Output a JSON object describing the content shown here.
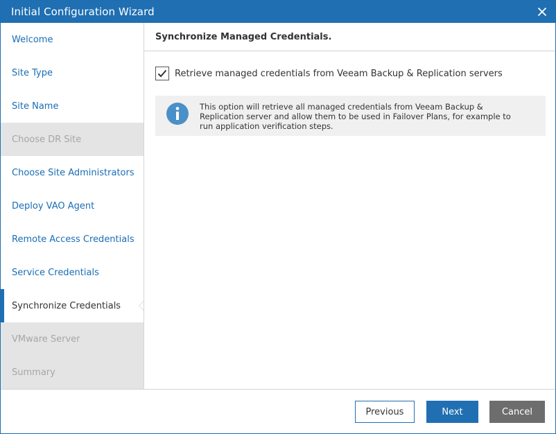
{
  "window": {
    "title": "Initial Configuration Wizard",
    "close_icon": "close-icon"
  },
  "sidebar": {
    "items": [
      {
        "label": "Welcome",
        "state": "link"
      },
      {
        "label": "Site Type",
        "state": "link"
      },
      {
        "label": "Site Name",
        "state": "link"
      },
      {
        "label": "Choose DR Site",
        "state": "disabled"
      },
      {
        "label": "Choose Site Administrators",
        "state": "link"
      },
      {
        "label": "Deploy VAO Agent",
        "state": "link"
      },
      {
        "label": "Remote Access Credentials",
        "state": "link"
      },
      {
        "label": "Service Credentials",
        "state": "link"
      },
      {
        "label": "Synchronize Credentials",
        "state": "active"
      },
      {
        "label": "VMware Server",
        "state": "disabled"
      },
      {
        "label": "Summary",
        "state": "disabled"
      }
    ]
  },
  "content": {
    "header": "Synchronize Managed Credentials.",
    "checkbox": {
      "label": "Retrieve managed credentials from Veeam Backup & Replication servers",
      "checked": true
    },
    "info": {
      "icon": "info-icon",
      "text": "This option will retrieve all managed credentials from Veeam Backup & Replication server and allow them to be used in Failover Plans, for example to run application verification steps."
    }
  },
  "footer": {
    "previous_label": "Previous",
    "next_label": "Next",
    "cancel_label": "Cancel"
  },
  "colors": {
    "accent": "#1f6fb2",
    "link": "#1a6db5",
    "disabled_bg": "#e4e4e4",
    "cancel_bg": "#6d6d6d"
  }
}
